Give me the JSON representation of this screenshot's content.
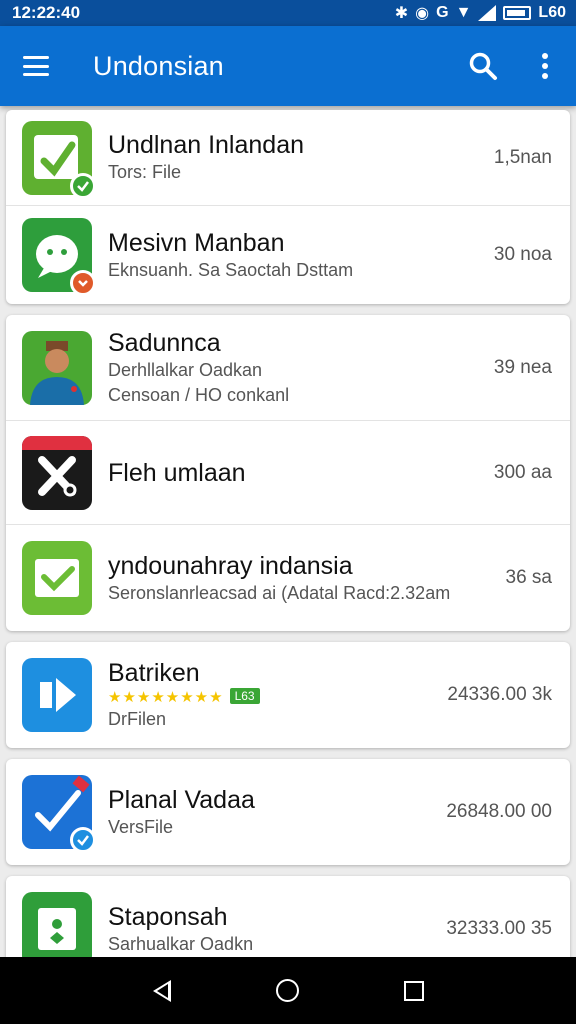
{
  "status": {
    "time": "12:22:40",
    "battery_text": "L60"
  },
  "appbar": {
    "title": "Undonsian"
  },
  "items": [
    {
      "name": "Undlnan  Inlandan",
      "sub1": "Tors: File",
      "size": "1,5nan",
      "icon_bg": "#5fb030",
      "icon": "check-doc-icon"
    },
    {
      "name": "Mesivn Manban",
      "sub1": "Eknsuanh. Sa Saoctah Dsttam",
      "size": "30 noa",
      "icon_bg": "#2e9e3c",
      "icon": "chat-bubble-icon"
    },
    {
      "name": "Sadunnca",
      "sub1": "Derhllalkar Oadkan",
      "sub2": "Censoan / HO conkanl",
      "size": "39 nea",
      "icon_bg": "#4aa832",
      "icon": "person-avatar-icon"
    },
    {
      "name": "Fleh umlaan",
      "size": "300 aa",
      "icon_bg": "#1a1a1a",
      "icon": "tools-icon"
    },
    {
      "name": "yndounahray indansia",
      "sub1": "Seronslanrleacsad ai (Adatal Racd:2.32am",
      "size": "36 sa",
      "icon_bg": "#6cbd35",
      "icon": "check-box-icon"
    },
    {
      "name": "Batriken",
      "rating_chip": "L63",
      "sub1": "DrFilen",
      "size": "24336.00 3k",
      "icon_bg": "#1e8fe0",
      "icon": "arrow-logo-icon"
    },
    {
      "name": "Planal Vadaa",
      "sub1": "VersFile",
      "size": "26848.00 00",
      "icon_bg": "#1c72d6",
      "icon": "pen-check-icon"
    },
    {
      "name": "Staponsah",
      "sub1": "Sarhualkar Oadkn",
      "size": "32333.00 35",
      "icon_bg": "#2f9e3a",
      "icon": "bag-icon"
    }
  ],
  "nav": {
    "back": "back-icon",
    "home": "home-icon",
    "recents": "recents-icon"
  }
}
